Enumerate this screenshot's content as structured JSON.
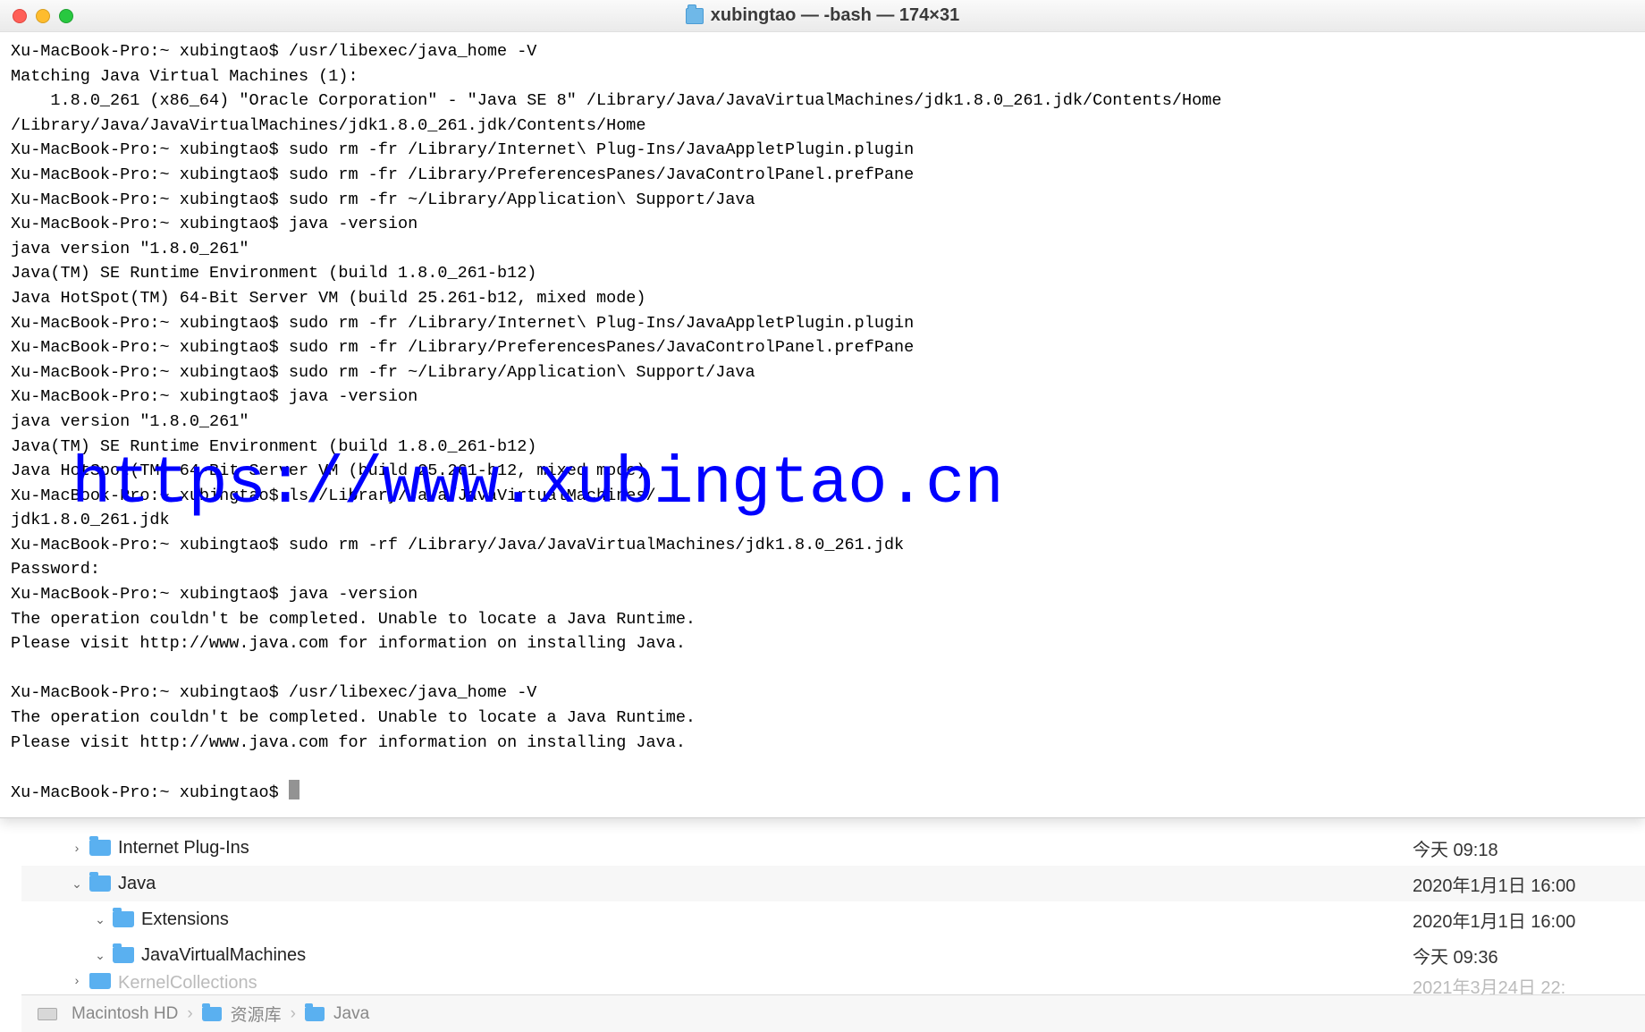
{
  "window": {
    "title": "xubingtao — -bash — 174×31"
  },
  "terminal": {
    "lines": [
      "Xu-MacBook-Pro:~ xubingtao$ /usr/libexec/java_home -V",
      "Matching Java Virtual Machines (1):",
      "    1.8.0_261 (x86_64) \"Oracle Corporation\" - \"Java SE 8\" /Library/Java/JavaVirtualMachines/jdk1.8.0_261.jdk/Contents/Home",
      "/Library/Java/JavaVirtualMachines/jdk1.8.0_261.jdk/Contents/Home",
      "Xu-MacBook-Pro:~ xubingtao$ sudo rm -fr /Library/Internet\\ Plug-Ins/JavaAppletPlugin.plugin",
      "Xu-MacBook-Pro:~ xubingtao$ sudo rm -fr /Library/PreferencesPanes/JavaControlPanel.prefPane",
      "Xu-MacBook-Pro:~ xubingtao$ sudo rm -fr ~/Library/Application\\ Support/Java",
      "Xu-MacBook-Pro:~ xubingtao$ java -version",
      "java version \"1.8.0_261\"",
      "Java(TM) SE Runtime Environment (build 1.8.0_261-b12)",
      "Java HotSpot(TM) 64-Bit Server VM (build 25.261-b12, mixed mode)",
      "Xu-MacBook-Pro:~ xubingtao$ sudo rm -fr /Library/Internet\\ Plug-Ins/JavaAppletPlugin.plugin",
      "Xu-MacBook-Pro:~ xubingtao$ sudo rm -fr /Library/PreferencesPanes/JavaControlPanel.prefPane",
      "Xu-MacBook-Pro:~ xubingtao$ sudo rm -fr ~/Library/Application\\ Support/Java",
      "Xu-MacBook-Pro:~ xubingtao$ java -version",
      "java version \"1.8.0_261\"",
      "Java(TM) SE Runtime Environment (build 1.8.0_261-b12)",
      "Java HotSpot(TM) 64-Bit Server VM (build 25.261-b12, mixed mode)",
      "Xu-MacBook-Pro:~ xubingtao$ ls /Library/Java/JavaVirtualMachines/",
      "jdk1.8.0_261.jdk",
      "Xu-MacBook-Pro:~ xubingtao$ sudo rm -rf /Library/Java/JavaVirtualMachines/jdk1.8.0_261.jdk",
      "Password:",
      "Xu-MacBook-Pro:~ xubingtao$ java -version",
      "The operation couldn't be completed. Unable to locate a Java Runtime.",
      "Please visit http://www.java.com for information on installing Java.",
      "",
      "Xu-MacBook-Pro:~ xubingtao$ /usr/libexec/java_home -V",
      "The operation couldn't be completed. Unable to locate a Java Runtime.",
      "Please visit http://www.java.com for information on installing Java.",
      ""
    ],
    "prompt": "Xu-MacBook-Pro:~ xubingtao$ "
  },
  "watermark": "https://www.xubingtao.cn",
  "finder": {
    "rows": [
      {
        "indent": 0,
        "arrow": "›",
        "name": "Internet Plug-Ins",
        "date": "今天 09:18"
      },
      {
        "indent": 0,
        "arrow": "⌄",
        "name": "Java",
        "date": "2020年1月1日 16:00"
      },
      {
        "indent": 1,
        "arrow": "⌄",
        "name": "Extensions",
        "date": "2020年1月1日 16:00"
      },
      {
        "indent": 1,
        "arrow": "⌄",
        "name": "JavaVirtualMachines",
        "date": "今天 09:36"
      },
      {
        "indent": 0,
        "arrow": "›",
        "name": "KernelCollections",
        "date": "2021年3月24日 22:"
      }
    ],
    "path": [
      "Macintosh HD",
      "资源库",
      "Java"
    ]
  }
}
